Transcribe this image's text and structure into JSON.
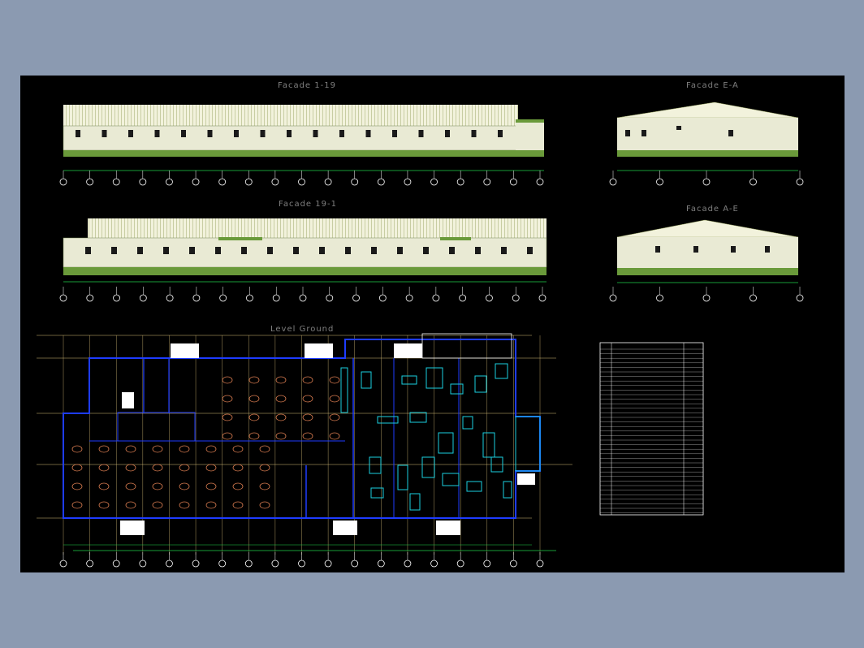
{
  "titles": {
    "facade_1_19": "Facade 1-19",
    "facade_e_a": "Facade E-A",
    "facade_19_1": "Facade 19-1",
    "facade_a_e": "Facade A-E",
    "level_ground": "Level Ground"
  },
  "colors": {
    "background": "#8b9ab1",
    "drawing_area": "#000000",
    "wall": "#e9ead4",
    "base": "#6a9a3a",
    "window": "#1a1a1a",
    "wall_lines": "#1e3cff",
    "grid": "#d9c07a",
    "dimension": "#1fd14a",
    "furniture": "#d4794e",
    "equipment": "#1ad0e0",
    "axis_bubble": "#ffffff"
  }
}
